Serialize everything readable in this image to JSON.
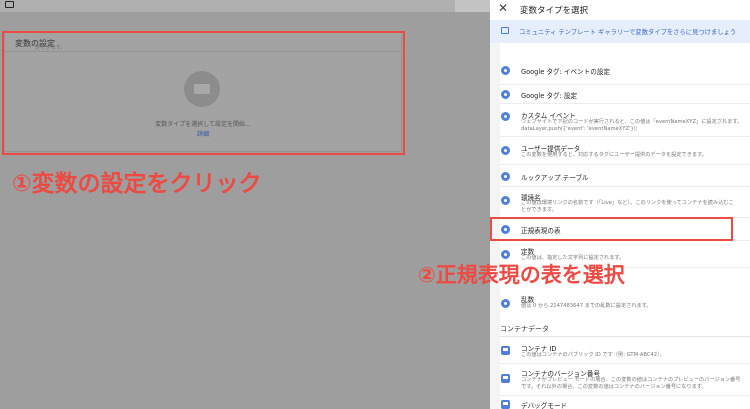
{
  "left": {
    "card_title": "変数の設定",
    "placeholder_text": "変数タイプを選択して設定を開始...",
    "detail_link": "詳細"
  },
  "panel": {
    "close_glyph": "✕",
    "title": "変数タイプを選択",
    "banner_text": "コミュニティ テンプレート ギャラリーで変数タイプをさらに見つけましょう",
    "top_partial_text": "定できます。",
    "items": [
      {
        "title": "Google タグ: イベントの設定",
        "desc": "",
        "desc2": ""
      },
      {
        "title": "Google タグ: 設定",
        "desc": "",
        "desc2": ""
      },
      {
        "title": "カスタム イベント",
        "desc": "ウェブサイトで下記のコードが実行されると、この値は「eventNameXYZ」に設定されます。",
        "desc2": "dataLayer.push({'event': 'eventNameXYZ'});"
      },
      {
        "title": "ユーザー提供データ",
        "desc": "この変数を使用すると、対応するタグにユーザー提供のデータを設定できます。",
        "desc2": ""
      },
      {
        "title": "ルックアップ テーブル",
        "desc": "",
        "desc2": ""
      },
      {
        "title": "環境名",
        "desc": "この値は環境リンクの名前です（「Live」など）。このリンクを使ってコンテナを読み込むこ",
        "desc2": "とができます。"
      },
      {
        "title": "正規表現の表",
        "desc": "",
        "desc2": ""
      },
      {
        "title": "定数",
        "desc": "この値は、指定した文字列に設定されます。",
        "desc2": ""
      },
      {
        "title": "乱数",
        "desc": "値は 0 から 2147483647 までの乱数に設定されます。",
        "desc2": ""
      }
    ],
    "section_container": "コンテナデータ",
    "container_items": [
      {
        "title": "コンテナ ID",
        "desc": "この値はコンテナのパブリック ID です（例: GTM-ABC42）。",
        "desc2": ""
      },
      {
        "title": "コンテナのバージョン番号",
        "desc": "コンテナがプレビュー モードの場合、この変数の値はコンテナのプレビューのバージョン番号",
        "desc2": "です。それ以外の場合、この変数の値はコンテナのバージョン番号になります。"
      },
      {
        "title": "デバッグモード",
        "desc": "",
        "desc2": ""
      }
    ]
  },
  "annotations": {
    "step1": "①変数の設定をクリック",
    "step2": "②正規表現の表を選択"
  },
  "colors": {
    "annotation_red": "#ec4a43",
    "icon_blue": "#4f7fd9",
    "banner_bg": "#e7eefb"
  }
}
